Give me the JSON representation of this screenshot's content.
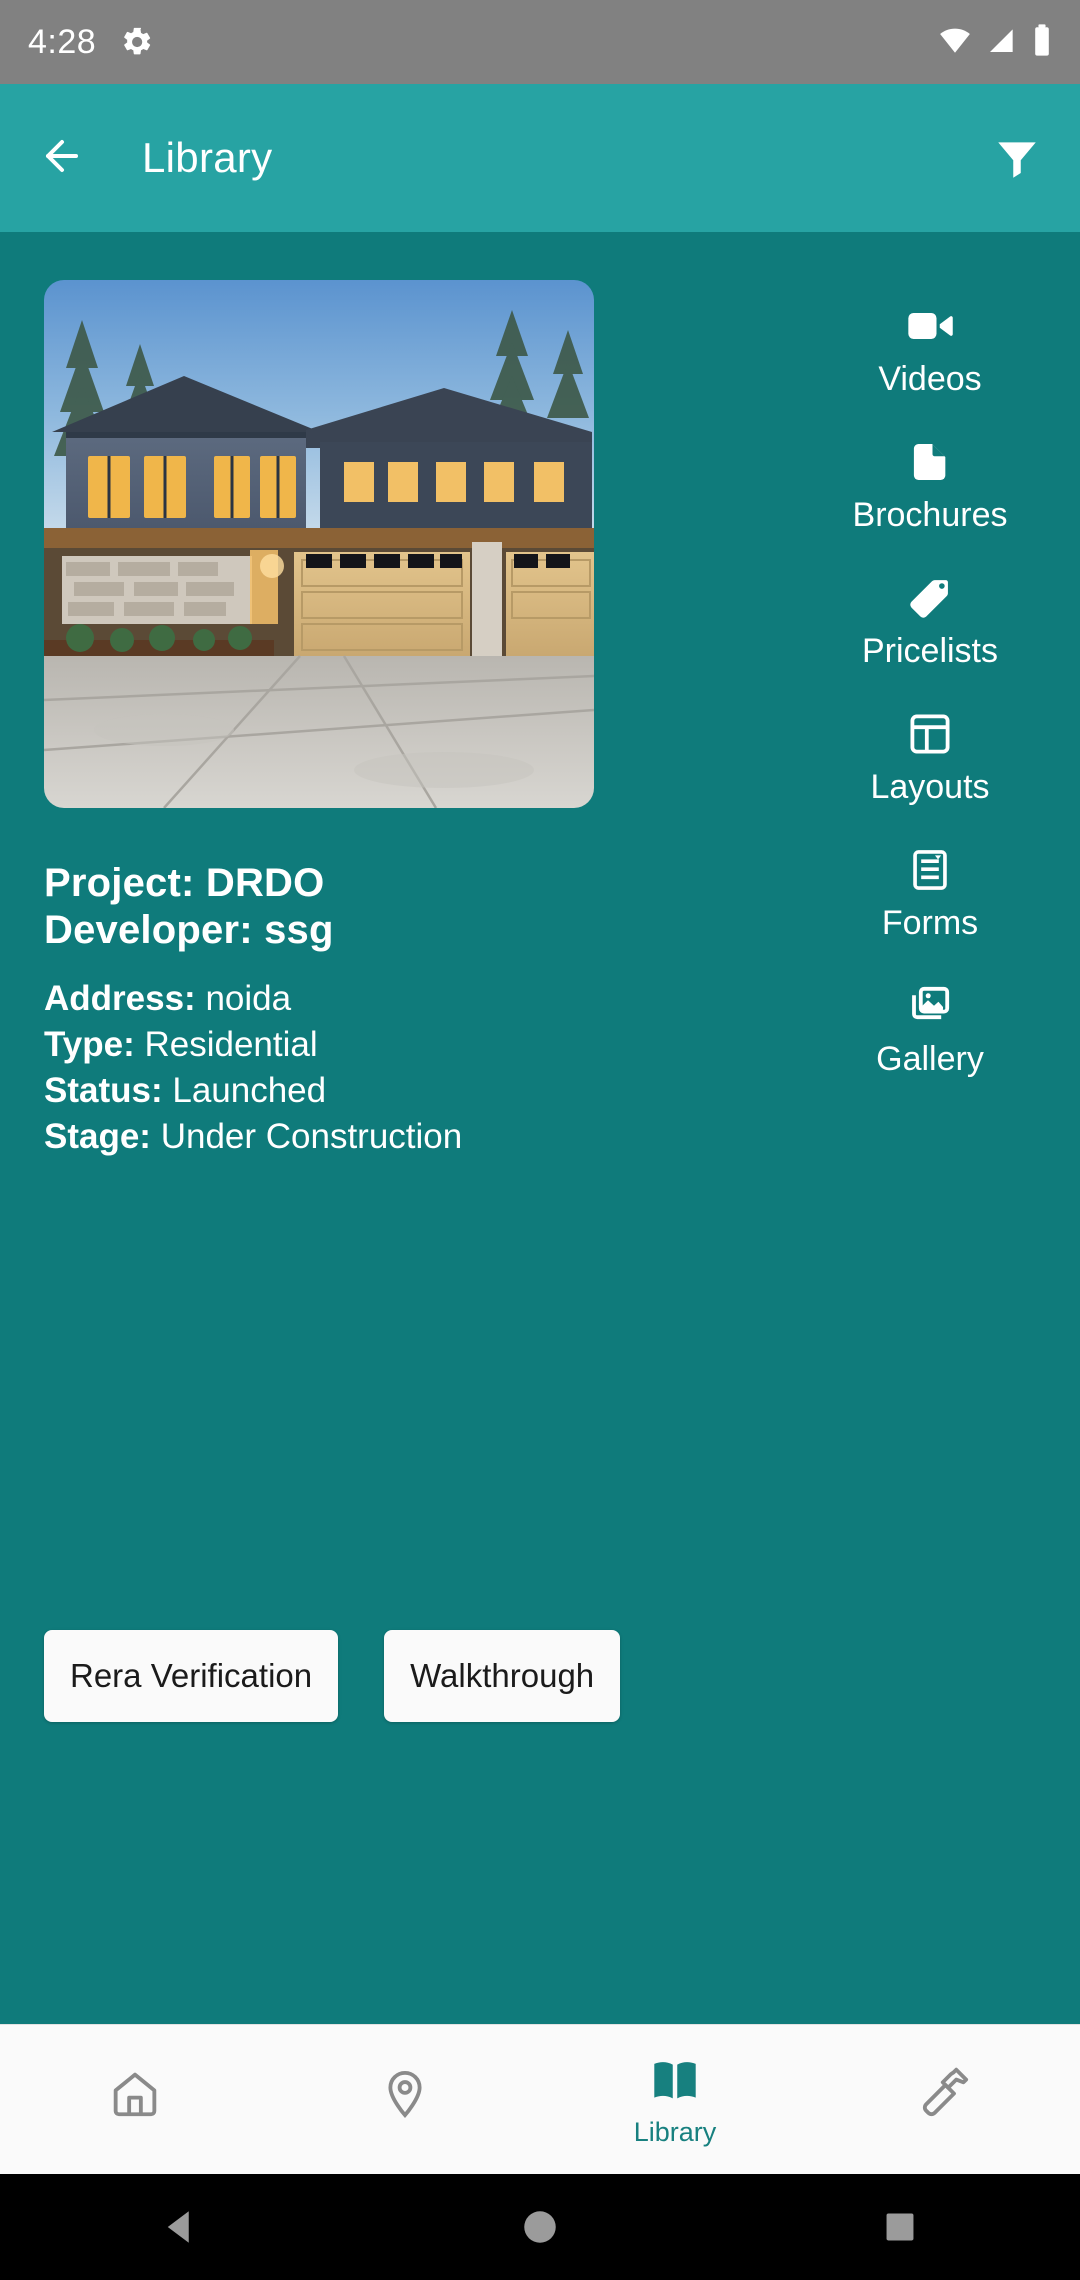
{
  "status_bar": {
    "time": "4:28",
    "icons": [
      "gear-icon",
      "wifi-icon",
      "cellular-signal-icon",
      "battery-icon"
    ],
    "background_color": "#818181"
  },
  "app_bar": {
    "back_icon": "back-arrow-icon",
    "title": "Library",
    "filter_icon": "filter-icon",
    "background_color": "#27A3A3"
  },
  "theme": {
    "body_background": "#0F7B7B",
    "accent": "#27A3A3",
    "active_nav": "#17807F",
    "card_surface": "#FAFAFA"
  },
  "project_card": {
    "photo_alt": "modern two-storey house with driveway and garages at dusk",
    "project_label": "Project:",
    "project_value": "DRDO",
    "developer_label": "Developer:",
    "developer_value": "ssg",
    "details": [
      {
        "label": "Address:",
        "value": "noida"
      },
      {
        "label": "Type:",
        "value": "Residential"
      },
      {
        "label": "Status:",
        "value": "Launched"
      },
      {
        "label": "Stage:",
        "value": "Under Construction"
      }
    ],
    "buttons": [
      {
        "label": "Rera Verification",
        "name": "rera-verification-button"
      },
      {
        "label": "Walkthrough",
        "name": "walkthrough-button"
      }
    ]
  },
  "side_menu": {
    "items": [
      {
        "label": "Videos",
        "icon": "video-camera-icon"
      },
      {
        "label": "Brochures",
        "icon": "document-icon"
      },
      {
        "label": "Pricelists",
        "icon": "price-tag-icon"
      },
      {
        "label": "Layouts",
        "icon": "layout-grid-icon"
      },
      {
        "label": "Forms",
        "icon": "form-document-icon"
      },
      {
        "label": "Gallery",
        "icon": "photo-gallery-icon"
      }
    ]
  },
  "bottom_nav": {
    "items": [
      {
        "label": "",
        "icon": "home-icon",
        "active": false
      },
      {
        "label": "",
        "icon": "map-pin-icon",
        "active": false
      },
      {
        "label": "Library",
        "icon": "book-icon",
        "active": true
      },
      {
        "label": "",
        "icon": "hammer-icon",
        "active": false
      }
    ]
  },
  "system_nav": {
    "back": "back-triangle-icon",
    "home": "home-circle-icon",
    "recents": "recents-square-icon"
  }
}
